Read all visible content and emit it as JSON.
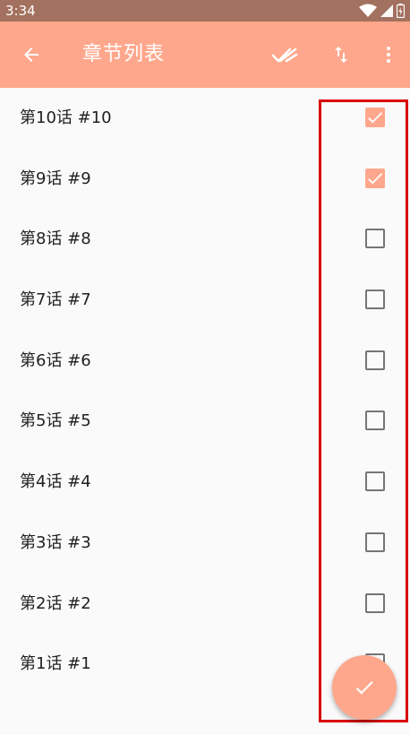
{
  "status_bar": {
    "time": "3:34",
    "icons": [
      "wifi-icon",
      "signal-icon",
      "battery-icon"
    ]
  },
  "toolbar": {
    "title": "章节列表",
    "background_color": "#ffa78c",
    "actions": [
      "back-arrow-icon",
      "done-all-icon",
      "sort-icon",
      "more-vert-icon"
    ]
  },
  "chapters": [
    {
      "label": "第10话 #10",
      "checked": true
    },
    {
      "label": "第9话 #9",
      "checked": true
    },
    {
      "label": "第8话 #8",
      "checked": false
    },
    {
      "label": "第7话 #7",
      "checked": false
    },
    {
      "label": "第6话 #6",
      "checked": false
    },
    {
      "label": "第5话 #5",
      "checked": false
    },
    {
      "label": "第4话 #4",
      "checked": false
    },
    {
      "label": "第3话 #3",
      "checked": false
    },
    {
      "label": "第2话 #2",
      "checked": false
    },
    {
      "label": "第1话 #1",
      "checked": false
    }
  ],
  "fab": {
    "icon": "check-icon",
    "color": "#ffa78c"
  },
  "highlight": {
    "color": "#d90000",
    "target": "checkbox-column"
  }
}
